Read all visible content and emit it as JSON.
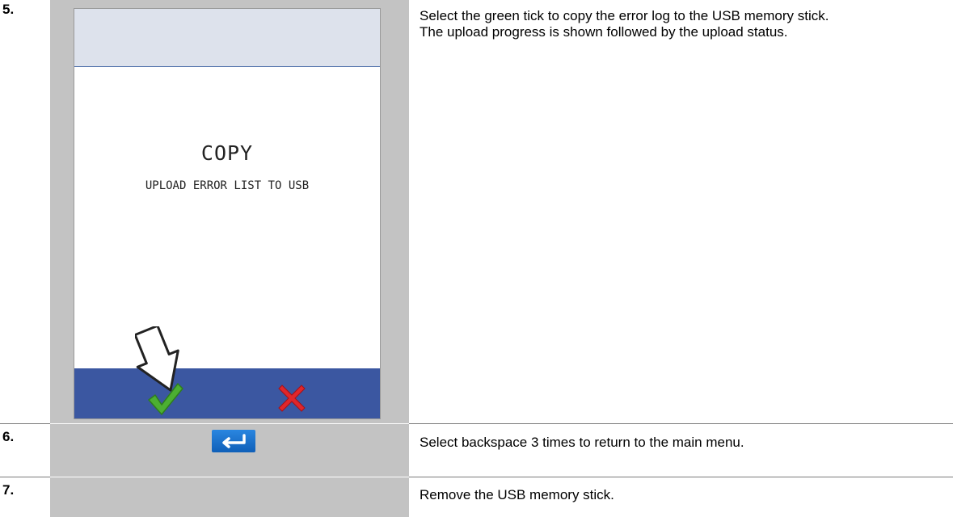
{
  "steps": [
    {
      "number": "5.",
      "desc_line1": "Select the green tick to copy the error log to the USB memory stick.",
      "desc_line2": "The upload progress is shown followed by the upload status.",
      "screen": {
        "title": "COPY",
        "subtitle": "UPLOAD ERROR LIST TO USB",
        "confirm_icon": "green-tick-icon",
        "cancel_icon": "red-cross-icon",
        "pointer_icon": "pointer-arrow-icon"
      }
    },
    {
      "number": "6.",
      "desc": "Select backspace 3 times to return to the main menu.",
      "button_icon": "backspace-icon"
    },
    {
      "number": "7.",
      "desc": "Remove the USB memory stick."
    }
  ],
  "colors": {
    "tick": "#4caf32",
    "cross": "#e0262b",
    "bar": "#3b57a1",
    "column": "#c3c3c3"
  }
}
